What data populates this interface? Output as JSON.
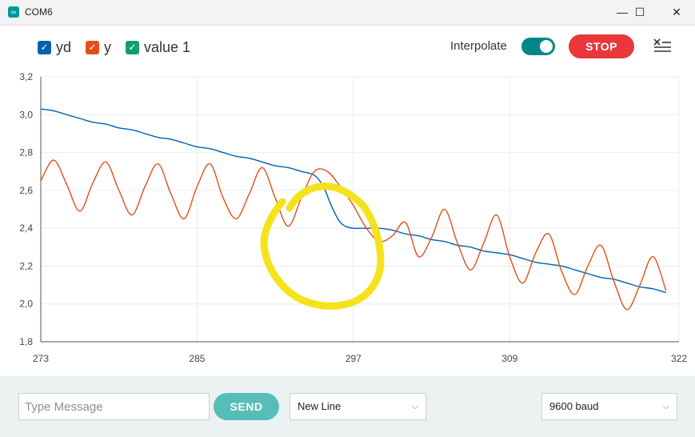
{
  "window": {
    "title": "COM6",
    "app_icon": "∞"
  },
  "legend": [
    {
      "label": "yd",
      "color": "#0060b0"
    },
    {
      "label": "y",
      "color": "#e0501a"
    },
    {
      "label": "value 1",
      "color": "#11a06a"
    }
  ],
  "controls": {
    "interpolate_label": "Interpolate",
    "interpolate_on": true,
    "stop_label": "STOP"
  },
  "chart_data": {
    "type": "line",
    "xlim": [
      273,
      322
    ],
    "ylim": [
      1.8,
      3.2
    ],
    "x_ticks": [
      "273",
      "285",
      "297",
      "309",
      "322"
    ],
    "y_ticks": [
      "1,8",
      "2,0",
      "2,2",
      "2,4",
      "2,6",
      "2,8",
      "3,0",
      "3,2"
    ],
    "grid": true,
    "series": [
      {
        "name": "yd",
        "color": "#0060b0",
        "points": [
          [
            273,
            3.03
          ],
          [
            274,
            3.02
          ],
          [
            275,
            3.0
          ],
          [
            276,
            2.98
          ],
          [
            277,
            2.96
          ],
          [
            278,
            2.95
          ],
          [
            279,
            2.93
          ],
          [
            280,
            2.92
          ],
          [
            281,
            2.9
          ],
          [
            282,
            2.88
          ],
          [
            283,
            2.87
          ],
          [
            284,
            2.85
          ],
          [
            285,
            2.83
          ],
          [
            286,
            2.82
          ],
          [
            287,
            2.8
          ],
          [
            288,
            2.78
          ],
          [
            289,
            2.77
          ],
          [
            290,
            2.75
          ],
          [
            291,
            2.73
          ],
          [
            292,
            2.72
          ],
          [
            293,
            2.7
          ],
          [
            294,
            2.68
          ],
          [
            294.7,
            2.62
          ],
          [
            295.3,
            2.52
          ],
          [
            295.9,
            2.44
          ],
          [
            296.4,
            2.41
          ],
          [
            297,
            2.4
          ],
          [
            298,
            2.4
          ],
          [
            299,
            2.4
          ],
          [
            300,
            2.39
          ],
          [
            301,
            2.37
          ],
          [
            302,
            2.36
          ],
          [
            303,
            2.34
          ],
          [
            304,
            2.33
          ],
          [
            305,
            2.31
          ],
          [
            306,
            2.3
          ],
          [
            307,
            2.28
          ],
          [
            308,
            2.27
          ],
          [
            309,
            2.26
          ],
          [
            310,
            2.24
          ],
          [
            311,
            2.22
          ],
          [
            312,
            2.21
          ],
          [
            313,
            2.2
          ],
          [
            314,
            2.18
          ],
          [
            315,
            2.16
          ],
          [
            316,
            2.14
          ],
          [
            317,
            2.13
          ],
          [
            318,
            2.11
          ],
          [
            319,
            2.09
          ],
          [
            320,
            2.08
          ],
          [
            321,
            2.06
          ]
        ]
      },
      {
        "name": "y",
        "color": "#e0501a",
        "points": [
          [
            273,
            2.65
          ],
          [
            274,
            2.76
          ],
          [
            275,
            2.63
          ],
          [
            276,
            2.49
          ],
          [
            277,
            2.64
          ],
          [
            278,
            2.75
          ],
          [
            279,
            2.6
          ],
          [
            280,
            2.47
          ],
          [
            281,
            2.62
          ],
          [
            282,
            2.74
          ],
          [
            283,
            2.58
          ],
          [
            284,
            2.45
          ],
          [
            285,
            2.62
          ],
          [
            286,
            2.74
          ],
          [
            287,
            2.56
          ],
          [
            288,
            2.45
          ],
          [
            289,
            2.58
          ],
          [
            290,
            2.72
          ],
          [
            291,
            2.56
          ],
          [
            292,
            2.41
          ],
          [
            293,
            2.56
          ],
          [
            294,
            2.7
          ],
          [
            295,
            2.7
          ],
          [
            296,
            2.62
          ],
          [
            297,
            2.52
          ],
          [
            298,
            2.4
          ],
          [
            299,
            2.33
          ],
          [
            300,
            2.36
          ],
          [
            301,
            2.43
          ],
          [
            302,
            2.25
          ],
          [
            303,
            2.35
          ],
          [
            304,
            2.5
          ],
          [
            305,
            2.32
          ],
          [
            306,
            2.18
          ],
          [
            307,
            2.32
          ],
          [
            308,
            2.47
          ],
          [
            309,
            2.25
          ],
          [
            310,
            2.11
          ],
          [
            311,
            2.27
          ],
          [
            312,
            2.37
          ],
          [
            313,
            2.17
          ],
          [
            314,
            2.05
          ],
          [
            315,
            2.2
          ],
          [
            316,
            2.31
          ],
          [
            317,
            2.12
          ],
          [
            318,
            1.97
          ],
          [
            319,
            2.1
          ],
          [
            320,
            2.25
          ],
          [
            321,
            2.07
          ]
        ]
      }
    ]
  },
  "footer": {
    "message_placeholder": "Type Message",
    "send_label": "SEND",
    "line_ending": "New Line",
    "baud": "9600 baud"
  }
}
